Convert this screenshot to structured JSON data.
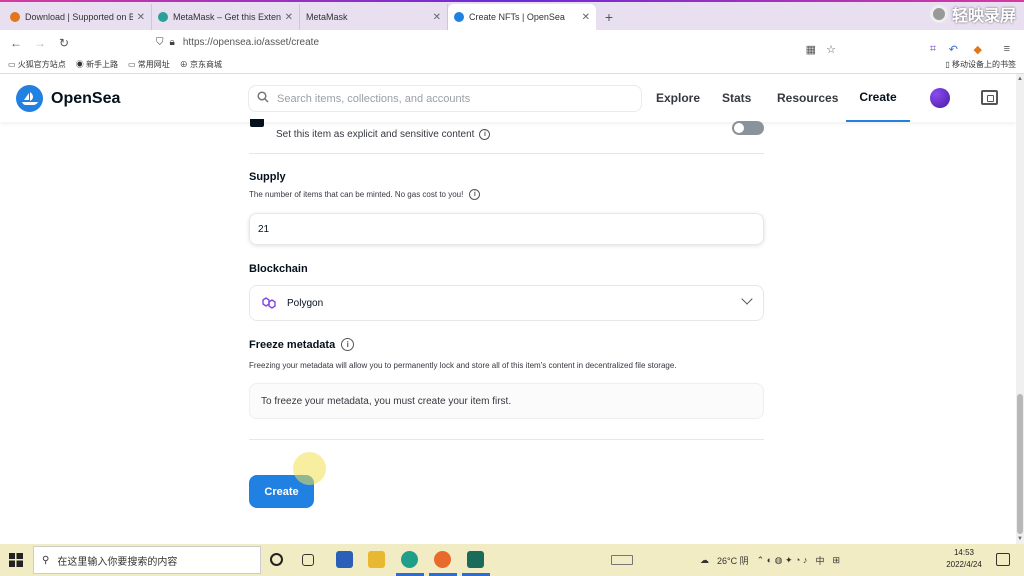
{
  "browser": {
    "tabs": [
      {
        "label": "Download | Supported on Br",
        "favicon_color": "#e2761b",
        "active": false
      },
      {
        "label": "MetaMask – Get this Extensio",
        "favicon_color": "#2aa198",
        "active": false
      },
      {
        "label": "MetaMask",
        "favicon_color": "#e2761b",
        "active": false
      },
      {
        "label": "Create NFTs | OpenSea",
        "favicon_color": "#2081e2",
        "active": true
      }
    ],
    "new_tab": "+",
    "recorder_label": "轻映录屏",
    "url": "https://opensea.io/asset/create",
    "bookmarks": [
      "火狐官方站点",
      "新手上路",
      "常用网址",
      "京东商城"
    ],
    "bookmarks_right": "移动设备上的书签"
  },
  "header": {
    "brand": "OpenSea",
    "search_placeholder": "Search items, collections, and accounts",
    "nav": {
      "explore": "Explore",
      "stats": "Stats",
      "resources": "Resources",
      "create": "Create"
    }
  },
  "form": {
    "explicit_sub": "Set this item as explicit and sensitive content",
    "explicit_enabled": false,
    "supply_label": "Supply",
    "supply_desc": "The number of items that can be minted. No gas cost to you!",
    "supply_value": "21",
    "blockchain_label": "Blockchain",
    "blockchain_value": "Polygon",
    "freeze_label": "Freeze metadata",
    "freeze_desc": "Freezing your metadata will allow you to permanently lock and store all of this item's content in decentralized file storage.",
    "freeze_box": "To freeze your metadata, you must create your item first.",
    "create_button": "Create"
  },
  "taskbar": {
    "search_placeholder": "在这里输入你要搜索的内容",
    "weather": "26°C 阴",
    "ime": "中",
    "time": "14:53",
    "date": "2022/4/24"
  },
  "colors": {
    "accent": "#2081e2",
    "taskbar": "#f2ecc4",
    "tabstrip": "#e8dff1"
  }
}
